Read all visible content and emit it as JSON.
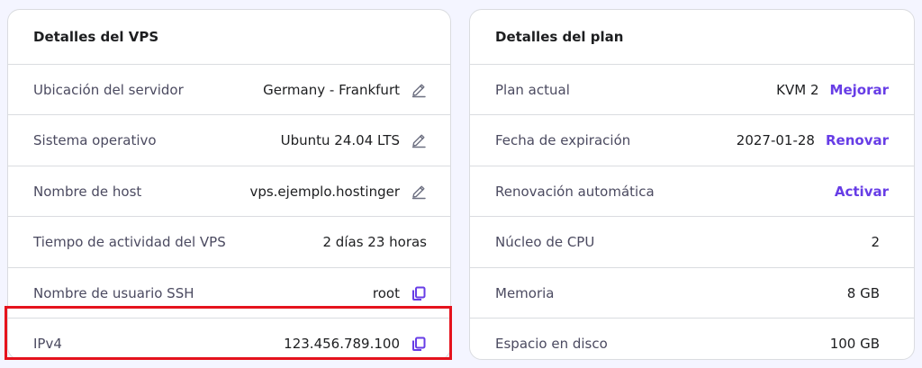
{
  "vps_details": {
    "title": "Detalles del VPS",
    "rows": [
      {
        "label": "Ubicación del servidor",
        "value": "Germany - Frankfurt",
        "action_icon": "pencil-icon"
      },
      {
        "label": "Sistema operativo",
        "value": "Ubuntu 24.04 LTS",
        "action_icon": "pencil-icon"
      },
      {
        "label": "Nombre de host",
        "value": "vps.ejemplo.hostinger",
        "action_icon": "pencil-icon"
      },
      {
        "label": "Tiempo de actividad del VPS",
        "value": "2 días 23 horas"
      },
      {
        "label": "Nombre de usuario SSH",
        "value": "root",
        "action_icon": "copy-icon"
      },
      {
        "label": "IPv4",
        "value": "123.456.789.100",
        "action_icon": "copy-icon"
      }
    ]
  },
  "plan_details": {
    "title": "Detalles del plan",
    "rows": [
      {
        "label": "Plan actual",
        "value": "KVM 2",
        "link": "Mejorar"
      },
      {
        "label": "Fecha de expiración",
        "value": "2027-01-28",
        "link": "Renovar"
      },
      {
        "label": "Renovación automática",
        "link": "Activar"
      },
      {
        "label": "Núcleo de CPU",
        "value": "2"
      },
      {
        "label": "Memoria",
        "value": "8 GB"
      },
      {
        "label": "Espacio en disco",
        "value": "100 GB"
      }
    ]
  },
  "colors": {
    "accent": "#673de6",
    "highlight": "#e5131d",
    "background": "#f4f5ff"
  }
}
